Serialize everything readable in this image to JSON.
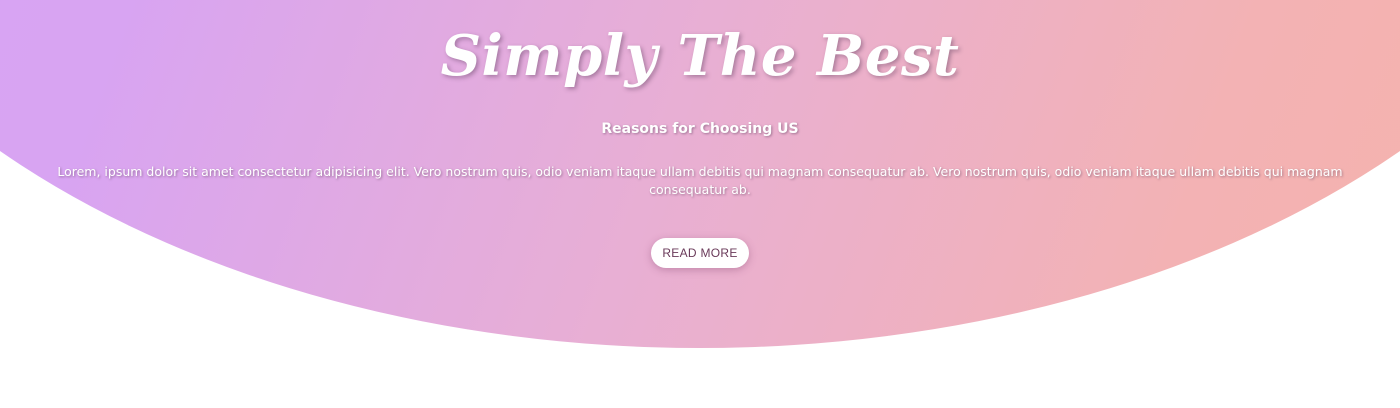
{
  "hero": {
    "title": "Simply The Best",
    "subtitle": "Reasons for Choosing US",
    "body": "Lorem, ipsum dolor sit amet consectetur adipisicing elit. Vero nostrum quis, odio veniam itaque ullam debitis qui magnam consequatur ab. Vero nostrum quis, odio veniam itaque ullam debitis qui magnam consequatur ab.",
    "button_label": "READ MORE",
    "colors": {
      "gradient_start": "#d5a2f7",
      "gradient_end": "#f6b4a8",
      "text": "#ffffff",
      "button_text": "#6a3a5a"
    }
  }
}
